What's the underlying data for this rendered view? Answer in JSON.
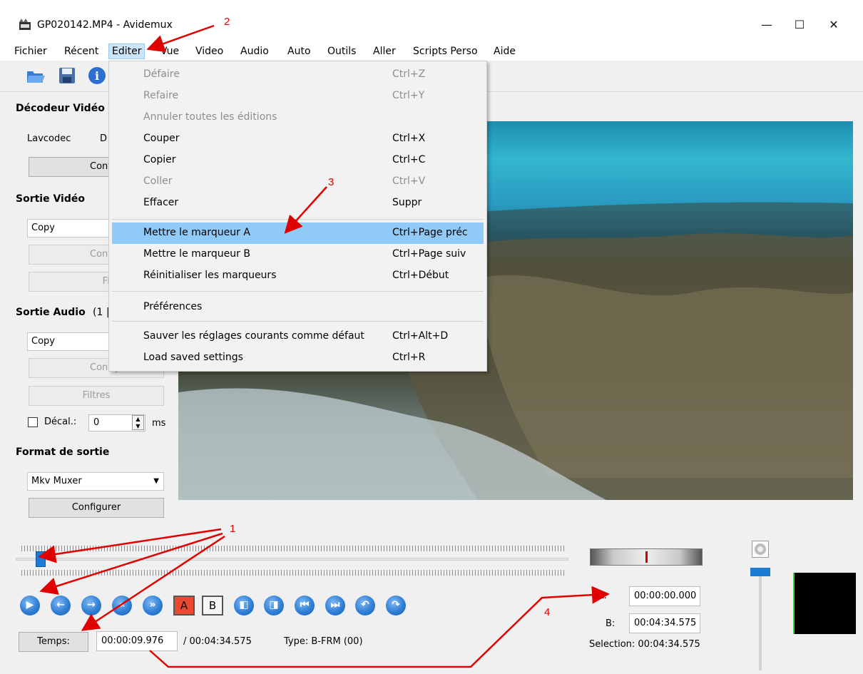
{
  "window": {
    "title": "GP020142.MP4 - Avidemux",
    "controls": {
      "minimize": "—",
      "maximize": "☐",
      "close": "✕"
    }
  },
  "menubar": [
    "Fichier",
    "Récent",
    "Editer",
    "Vue",
    "Video",
    "Audio",
    "Auto",
    "Outils",
    "Aller",
    "Scripts Perso",
    "Aide"
  ],
  "edit_menu": [
    {
      "label": "Défaire",
      "shortcut": "Ctrl+Z",
      "enabled": false
    },
    {
      "label": "Refaire",
      "shortcut": "Ctrl+Y",
      "enabled": false
    },
    {
      "label": "Annuler toutes les éditions",
      "shortcut": "",
      "enabled": false
    },
    {
      "label": "Couper",
      "shortcut": "Ctrl+X",
      "enabled": true
    },
    {
      "label": "Copier",
      "shortcut": "Ctrl+C",
      "enabled": true
    },
    {
      "label": "Coller",
      "shortcut": "Ctrl+V",
      "enabled": false
    },
    {
      "label": "Effacer",
      "shortcut": "Suppr",
      "enabled": true
    },
    {
      "label": "Mettre le marqueur A",
      "shortcut": "Ctrl+Page préc",
      "enabled": true,
      "highlighted": true
    },
    {
      "label": "Mettre le marqueur B",
      "shortcut": "Ctrl+Page suiv",
      "enabled": true
    },
    {
      "label": "Réinitialiser les marqueurs",
      "shortcut": "Ctrl+Début",
      "enabled": true
    },
    {
      "label": "Préférences",
      "shortcut": "",
      "enabled": true
    },
    {
      "label": "Sauver les réglages courants comme défaut",
      "shortcut": "Ctrl+Alt+D",
      "enabled": true
    },
    {
      "label": "Load saved settings",
      "shortcut": "Ctrl+R",
      "enabled": true
    }
  ],
  "left_panel": {
    "video_decoder": {
      "title": "Décodeur Vidéo",
      "codec": "Lavcodec",
      "codec_value": "D",
      "configure": "Configu"
    },
    "video_output": {
      "title": "Sortie Vidéo",
      "codec": "Copy",
      "configure": "Configu",
      "filters": "Filtres"
    },
    "audio_output": {
      "title": "Sortie Audio",
      "track": "(1 |",
      "codec": "Copy",
      "configure": "Configu",
      "filters": "Filtres",
      "shift_label": "Décal.:",
      "shift_value": "0",
      "shift_unit": "ms"
    },
    "output_format": {
      "title": "Format de sortie",
      "muxer": "Mkv Muxer",
      "configure": "Configurer"
    }
  },
  "timeline": {
    "time_button": "Temps:",
    "current_time": "00:00:09.976",
    "total_time": "/ 00:04:34.575",
    "frame_type": "Type:  B-FRM (00)",
    "progress_fraction": 0.036
  },
  "markers": {
    "a_label": "A:",
    "a_value": "00:00:00.000",
    "b_label": "B:",
    "b_value": "00:04:34.575",
    "selection": "Selection: 00:04:34.575"
  },
  "annotations": [
    "1",
    "2",
    "3",
    "4"
  ],
  "accent_color": "#e00000"
}
